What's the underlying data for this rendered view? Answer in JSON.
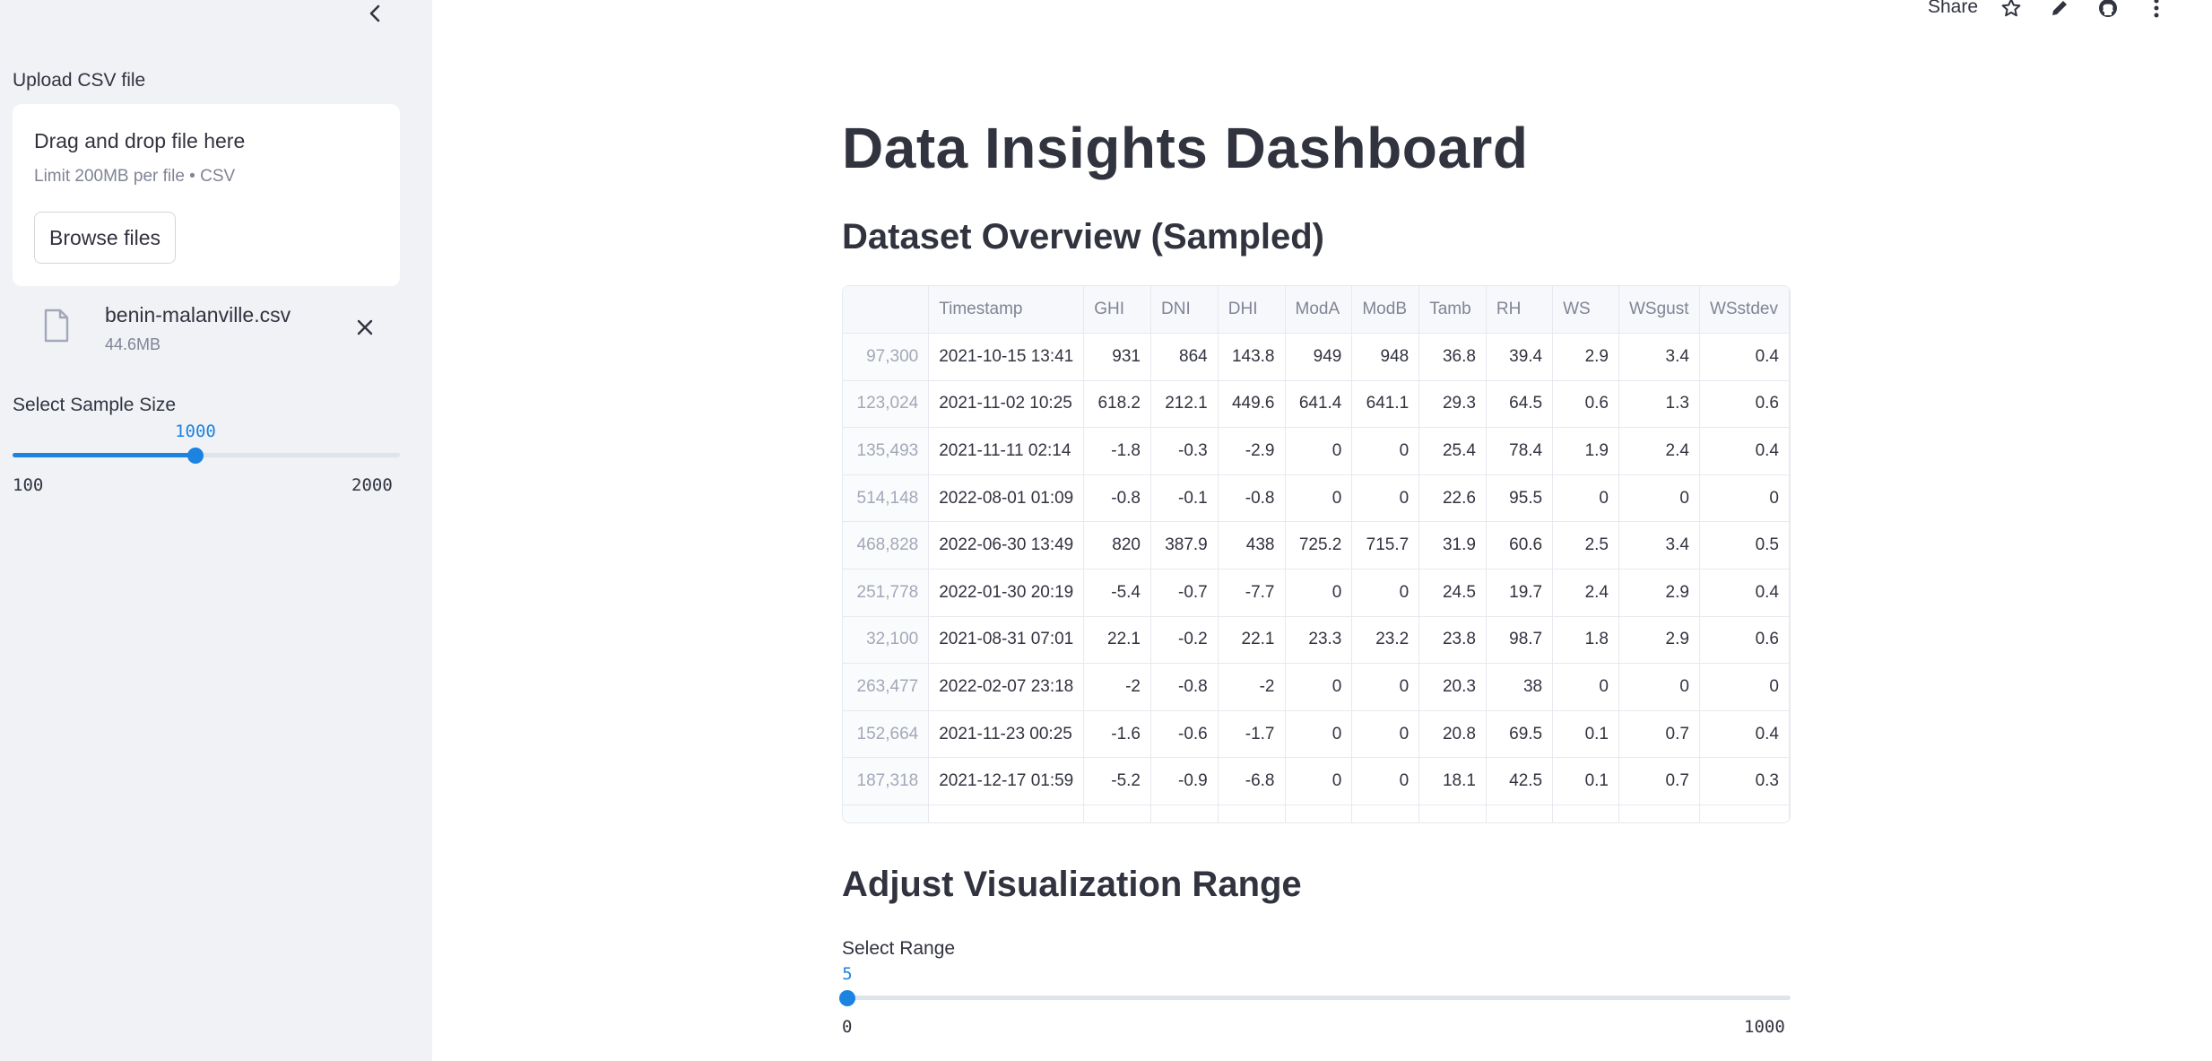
{
  "sidebar": {
    "upload_label": "Upload CSV file",
    "dropzone_title": "Drag and drop file here",
    "dropzone_subtitle": "Limit 200MB per file • CSV",
    "browse_label": "Browse files",
    "file_name": "benin-malanville.csv",
    "file_size": "44.6MB",
    "sample_slider": {
      "label": "Select Sample Size",
      "value": "1000",
      "min": "100",
      "max": "2000"
    }
  },
  "toolbar": {
    "share_label": "Share",
    "icons": [
      "star-icon",
      "pencil-icon",
      "github-icon",
      "more-vertical-icon"
    ]
  },
  "main": {
    "title": "Data Insights Dashboard",
    "overview_heading": "Dataset Overview (Sampled)",
    "table": {
      "columns": [
        "",
        "Timestamp",
        "GHI",
        "DNI",
        "DHI",
        "ModA",
        "ModB",
        "Tamb",
        "RH",
        "WS",
        "WSgust",
        "WSstdev"
      ],
      "rows": [
        [
          "97,300",
          "2021-10-15 13:41",
          "931",
          "864",
          "143.8",
          "949",
          "948",
          "36.8",
          "39.4",
          "2.9",
          "3.4",
          "0.4"
        ],
        [
          "123,024",
          "2021-11-02 10:25",
          "618.2",
          "212.1",
          "449.6",
          "641.4",
          "641.1",
          "29.3",
          "64.5",
          "0.6",
          "1.3",
          "0.6"
        ],
        [
          "135,493",
          "2021-11-11 02:14",
          "-1.8",
          "-0.3",
          "-2.9",
          "0",
          "0",
          "25.4",
          "78.4",
          "1.9",
          "2.4",
          "0.4"
        ],
        [
          "514,148",
          "2022-08-01 01:09",
          "-0.8",
          "-0.1",
          "-0.8",
          "0",
          "0",
          "22.6",
          "95.5",
          "0",
          "0",
          "0"
        ],
        [
          "468,828",
          "2022-06-30 13:49",
          "820",
          "387.9",
          "438",
          "725.2",
          "715.7",
          "31.9",
          "60.6",
          "2.5",
          "3.4",
          "0.5"
        ],
        [
          "251,778",
          "2022-01-30 20:19",
          "-5.4",
          "-0.7",
          "-7.7",
          "0",
          "0",
          "24.5",
          "19.7",
          "2.4",
          "2.9",
          "0.4"
        ],
        [
          "32,100",
          "2021-08-31 07:01",
          "22.1",
          "-0.2",
          "22.1",
          "23.3",
          "23.2",
          "23.8",
          "98.7",
          "1.8",
          "2.9",
          "0.6"
        ],
        [
          "263,477",
          "2022-02-07 23:18",
          "-2",
          "-0.8",
          "-2",
          "0",
          "0",
          "20.3",
          "38",
          "0",
          "0",
          "0"
        ],
        [
          "152,664",
          "2021-11-23 00:25",
          "-1.6",
          "-0.6",
          "-1.7",
          "0",
          "0",
          "20.8",
          "69.5",
          "0.1",
          "0.7",
          "0.4"
        ],
        [
          "187,318",
          "2021-12-17 01:59",
          "-5.2",
          "-0.9",
          "-6.8",
          "0",
          "0",
          "18.1",
          "42.5",
          "0.1",
          "0.7",
          "0.3"
        ]
      ]
    },
    "range_heading": "Adjust Visualization Range",
    "range_slider": {
      "label": "Select Range",
      "value": "5",
      "min": "0",
      "max": "1000"
    }
  },
  "colors": {
    "accent": "#1c83e1",
    "sidebar_bg": "#f0f2f6",
    "text": "#31333f",
    "muted": "#808495"
  }
}
